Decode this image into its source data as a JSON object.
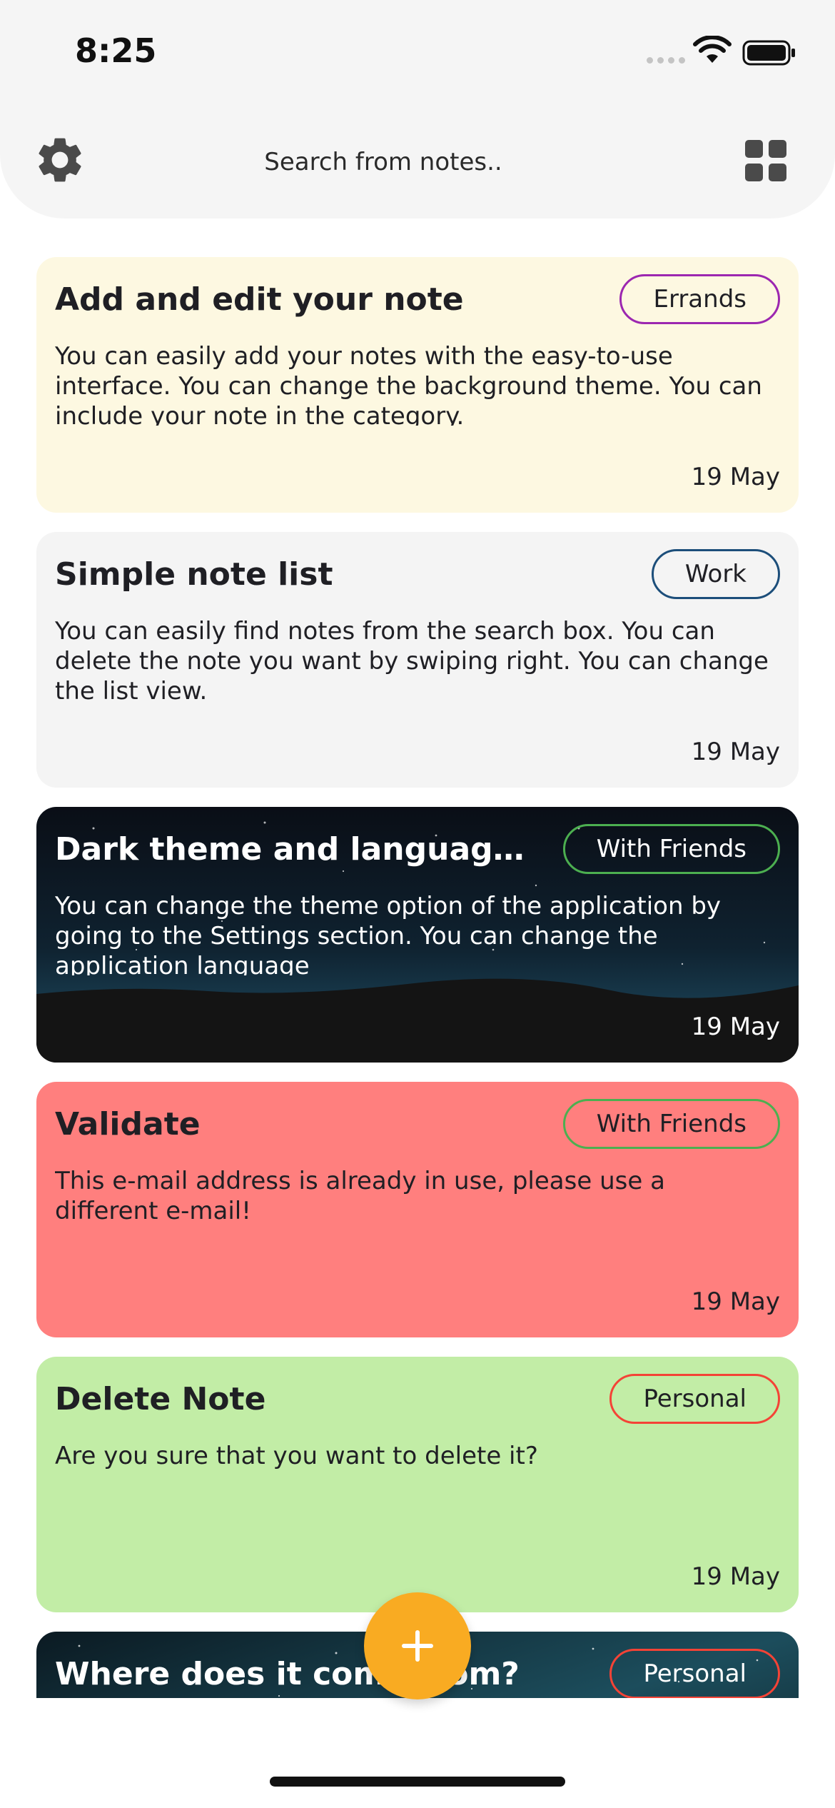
{
  "status_bar": {
    "time": "8:25"
  },
  "search": {
    "placeholder": "Search from notes.."
  },
  "icons": {
    "settings": "gear-icon",
    "layout": "grid-view-icon",
    "add": "plus-icon"
  },
  "notes": [
    {
      "title": "Add and edit your note",
      "category": "Errands",
      "body": "You can easily add your notes with the easy-to-use interface. You can change the background theme. You can include your note in the category.",
      "date": "19 May",
      "theme": "#fdf8e1",
      "badge_color": "#9c27b0"
    },
    {
      "title": "Simple note list",
      "category": "Work",
      "body": "You can easily find notes from the search box. You can delete the note you want by swiping right. You can change the list view.",
      "date": "19 May",
      "theme": "#f4f4f4",
      "badge_color": "#1c4e7a"
    },
    {
      "title": "Dark theme and language ...",
      "category": "With Friends",
      "body": "You can change the theme option of the application by going to the Settings section. You can change the application language",
      "date": "19 May",
      "theme": "night-sky",
      "badge_color": "#4caf50"
    },
    {
      "title": "Validate",
      "category": "With Friends",
      "body": "This e-mail address is already in use, please use a different e-mail!",
      "date": "19 May",
      "theme": "#ff7f7e",
      "badge_color": "#4caf50"
    },
    {
      "title": "Delete Note",
      "category": "Personal",
      "body": "Are you sure that you want to delete it?",
      "date": "19 May",
      "theme": "#c2eda6",
      "badge_color": "#f44336"
    },
    {
      "title": "Where does it come from?",
      "category": "Personal",
      "body": "",
      "date": "",
      "theme": "milky-way",
      "badge_color": "#f44336"
    }
  ]
}
